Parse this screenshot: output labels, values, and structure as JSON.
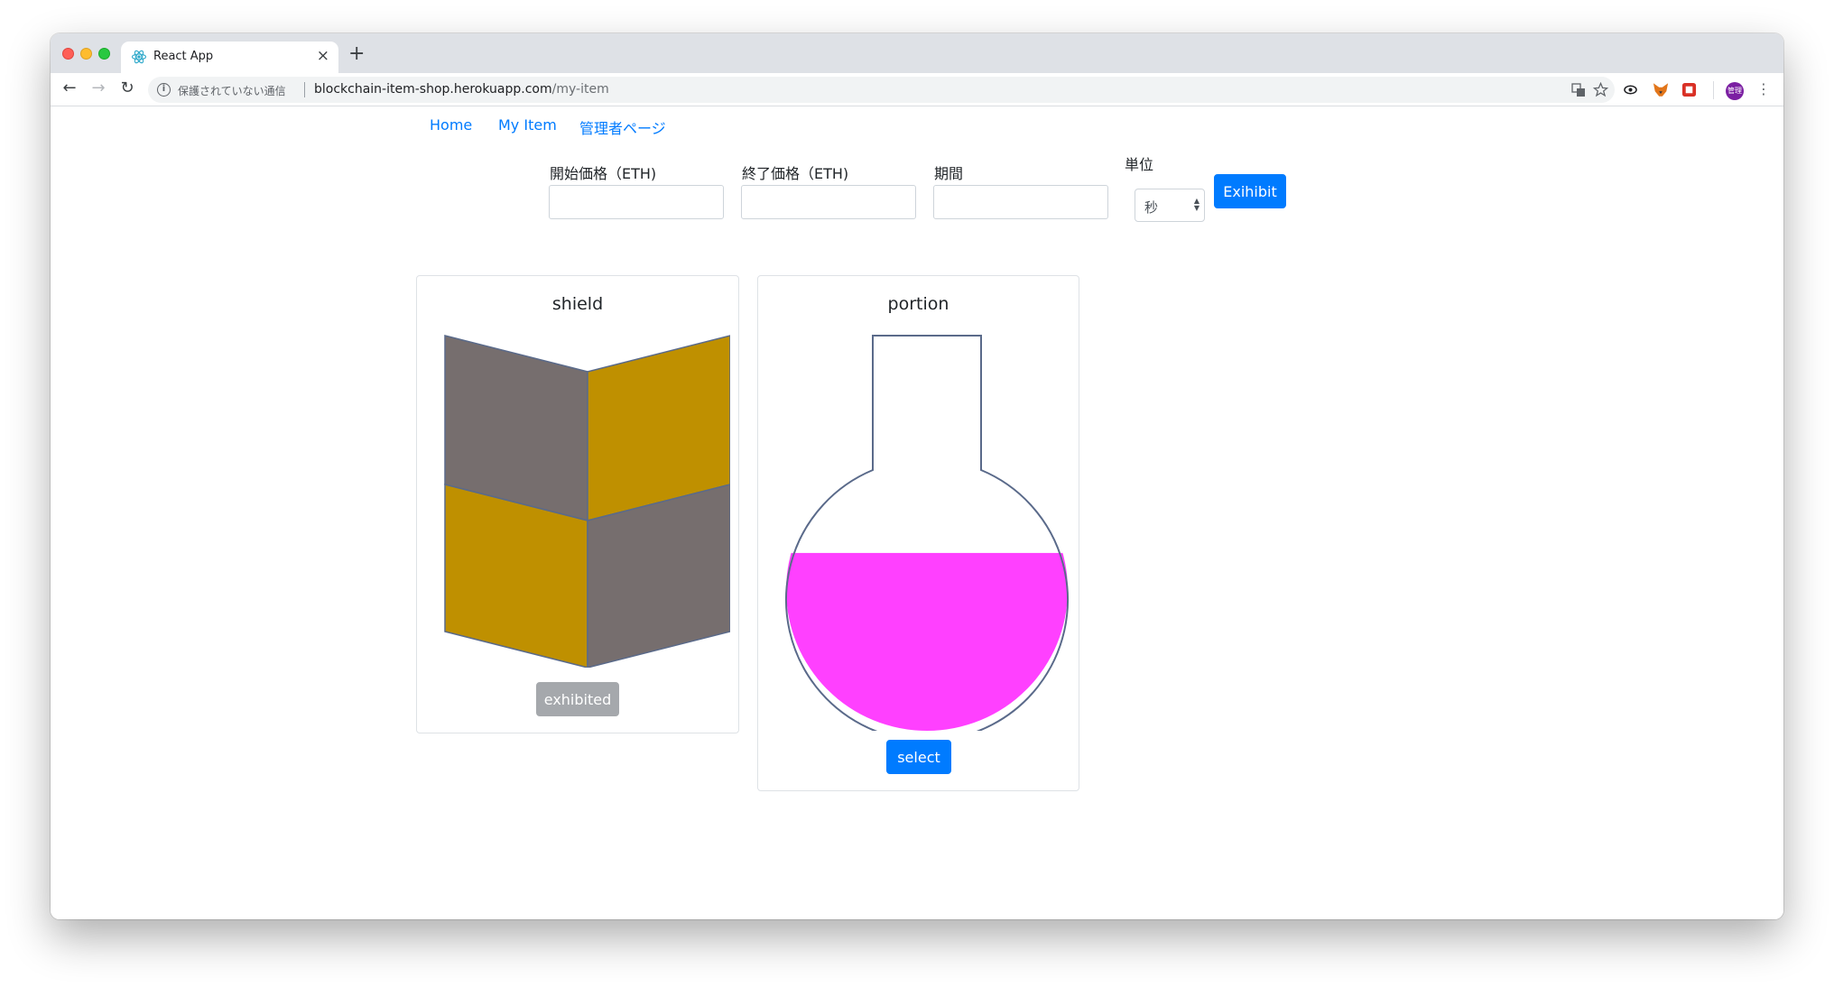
{
  "browser": {
    "tab_title": "React App",
    "tab_close_glyph": "×",
    "new_tab_glyph": "+",
    "security_label": "保護されていない通信",
    "url_host": "blockchain-item-shop.herokuapp.com",
    "url_path": "/my-item",
    "avatar_text": "管理"
  },
  "nav": {
    "home": "Home",
    "my_item": "My Item",
    "admin": "管理者ページ"
  },
  "form": {
    "start_price_label": "開始価格（ETH)",
    "start_price_value": "",
    "end_price_label": "終了価格（ETH)",
    "end_price_value": "",
    "period_label": "期間",
    "period_value": "",
    "unit_label": "単位",
    "unit_selected": "秒",
    "exhibit_button": "Exihibit"
  },
  "items": [
    {
      "name": "shield",
      "button": "exhibited",
      "button_state": "disabled",
      "colors": {
        "primary": "#bf9000",
        "secondary": "#766e6e"
      }
    },
    {
      "name": "portion",
      "button": "select",
      "button_state": "enabled",
      "liquid_level": 0.45,
      "colors": {
        "liquid": "#ff40ff"
      }
    }
  ],
  "colors": {
    "link": "#007bff",
    "primary_button": "#007bff",
    "disabled_button": "#a5a8ac"
  }
}
